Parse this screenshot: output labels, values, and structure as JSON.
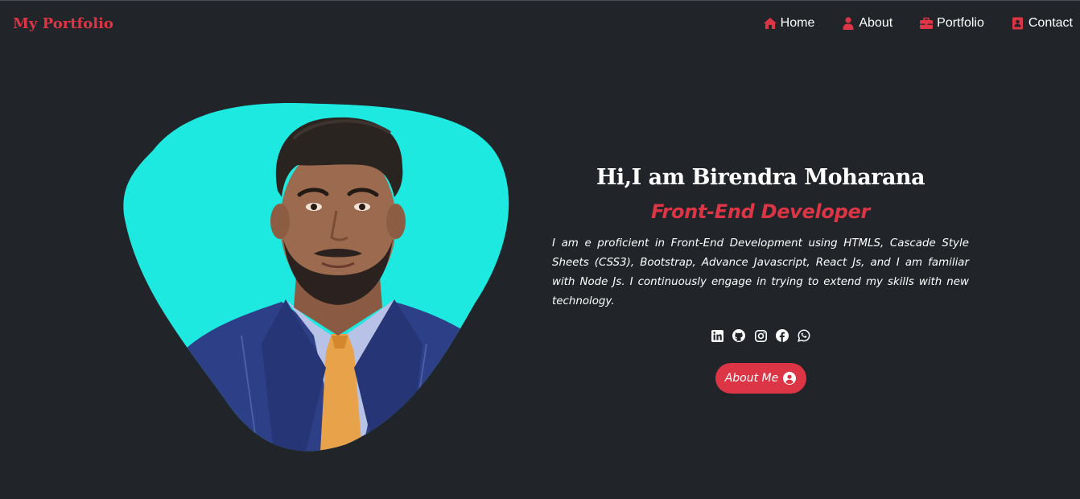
{
  "brand": "My Portfolio",
  "nav": {
    "items": [
      {
        "label": "Home",
        "icon": "home-icon"
      },
      {
        "label": "About",
        "icon": "user-icon"
      },
      {
        "label": "Portfolio",
        "icon": "briefcase-icon"
      },
      {
        "label": "Contact",
        "icon": "address-book-icon"
      }
    ]
  },
  "hero": {
    "title": "Hi,I am Birendra Moharana",
    "role": "Front-End Developer",
    "description": "I am e proficient in Front-End Development using HTMLS, Cascade Style Sheets (CSS3), Bootstrap, Advance Javascript, React Js, and I am familiar with Node Js. I continuously engage in trying to extend my skills with new technology.",
    "button_label": "About Me",
    "button_icon": "user-circle-icon",
    "socials": [
      "linkedin-icon",
      "github-icon",
      "instagram-icon",
      "facebook-icon",
      "whatsapp-icon"
    ]
  },
  "colors": {
    "background": "#212529",
    "accent": "#dc3545",
    "blob": "#1de9e0",
    "text": "#ffffff"
  }
}
